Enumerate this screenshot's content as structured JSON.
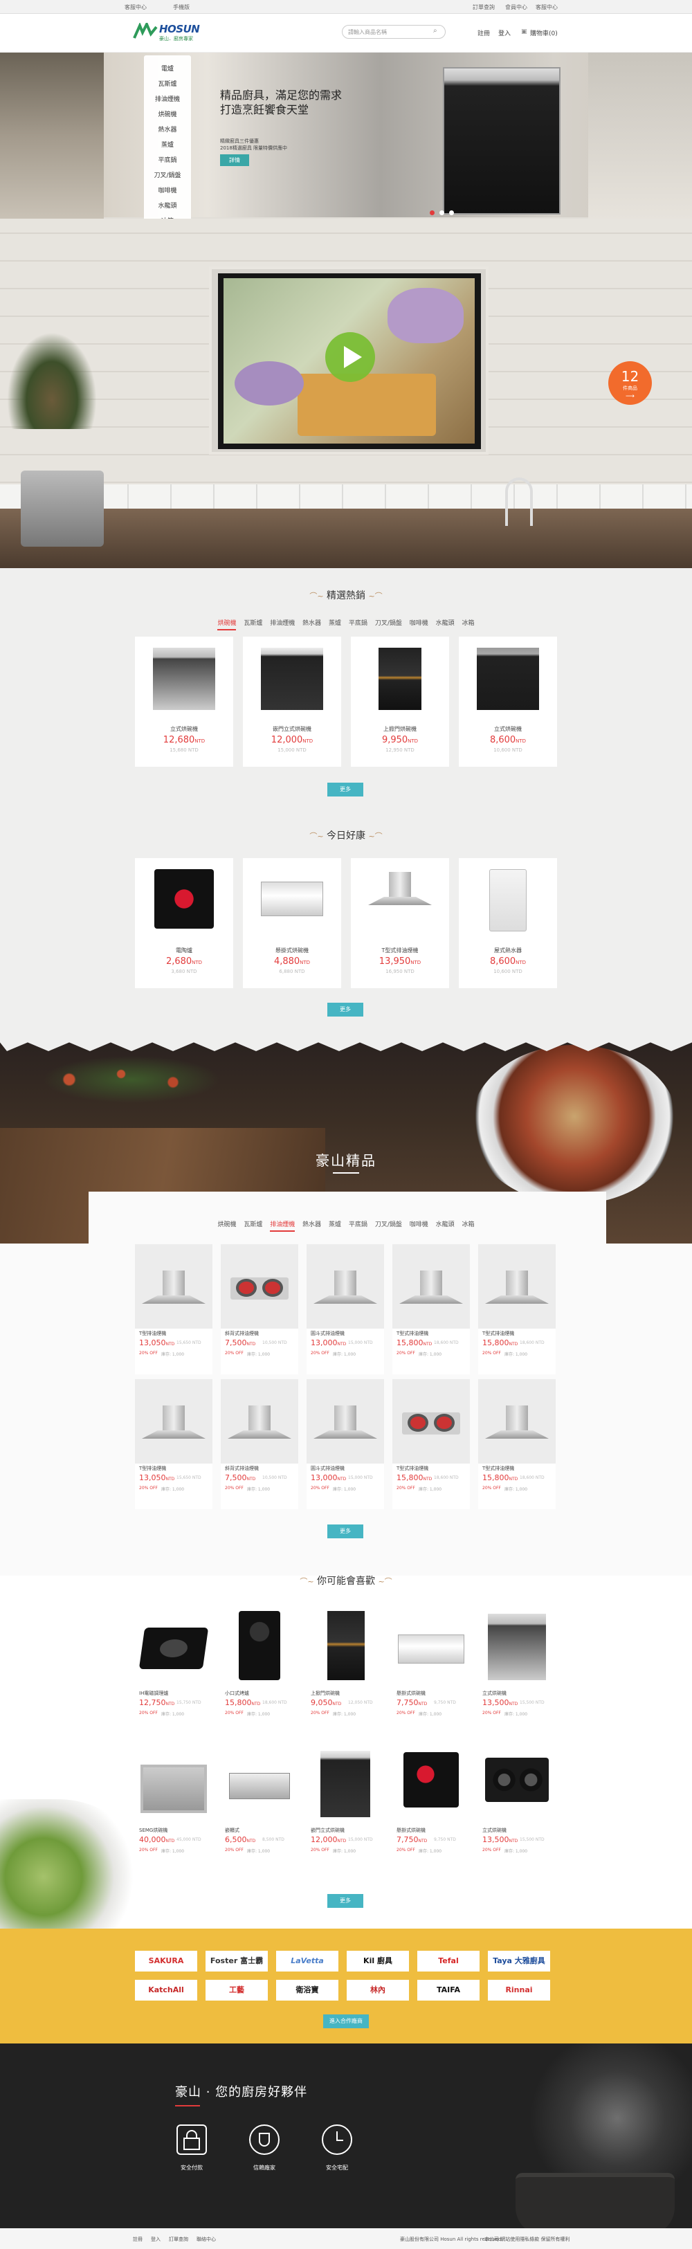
{
  "topbar": {
    "left": [
      "客服中心",
      "手機版"
    ],
    "right": [
      "訂單查詢",
      "會員中心",
      "客服中心"
    ]
  },
  "header": {
    "logo_text": "HOSUN",
    "logo_sub": "豪山．廚房專家",
    "search_placeholder": "請輸入商品名稱",
    "nav": [
      "註冊",
      "登入",
      "購物車(0)"
    ]
  },
  "categories": [
    "電爐",
    "瓦斯爐",
    "排油煙機",
    "烘碗機",
    "熱水器",
    "蒸爐",
    "平底鍋",
    "刀叉/鍋盤",
    "咖啡機",
    "水龍頭",
    "冰箱"
  ],
  "banner": {
    "title_1": "精品廚具，滿足您的需求",
    "title_2": "打造烹飪饗食天堂",
    "sub_1": "精緻廚具三件優惠",
    "sub_2": "2018精選廚具 限量特價供應中",
    "button": "詳情"
  },
  "event_badge": {
    "number": "12",
    "label": "件商品"
  },
  "hot": {
    "title": "精選熱銷",
    "tabs": [
      "烘碗機",
      "瓦斯爐",
      "排油煙機",
      "熱水器",
      "蒸爐",
      "平底鍋",
      "刀叉/鍋盤",
      "咖啡機",
      "水龍頭",
      "冰箱"
    ],
    "active_tab": 0,
    "items": [
      {
        "name": "立式烘碗機",
        "price": "12,680",
        "unit": "NTD",
        "old": "15,680 NTD"
      },
      {
        "name": "嵌門立式烘碗機",
        "price": "12,000",
        "unit": "NTD",
        "old": "15,000 NTD"
      },
      {
        "name": "上掀門烘碗機",
        "price": "9,950",
        "unit": "NTD",
        "old": "12,950 NTD"
      },
      {
        "name": "立式烘碗機",
        "price": "8,600",
        "unit": "NTD",
        "old": "10,600 NTD"
      }
    ],
    "more": "更多"
  },
  "today": {
    "title": "今日好康",
    "items": [
      {
        "name": "電陶爐",
        "price": "2,680",
        "unit": "NTD",
        "old": "3,680 NTD"
      },
      {
        "name": "懸掛式烘碗機",
        "price": "4,880",
        "unit": "NTD",
        "old": "6,880 NTD"
      },
      {
        "name": "T型式排油煙機",
        "price": "13,950",
        "unit": "NTD",
        "old": "16,950 NTD"
      },
      {
        "name": "屋式熱水器",
        "price": "8,600",
        "unit": "NTD",
        "old": "10,600 NTD"
      }
    ],
    "more": "更多"
  },
  "boutique": {
    "title": "豪山精品",
    "tabs": [
      "烘碗機",
      "瓦斯爐",
      "排油煙機",
      "熱水器",
      "蒸爐",
      "平底鍋",
      "刀叉/鍋盤",
      "咖啡機",
      "水龍頭",
      "冰箱"
    ],
    "active_tab": 2,
    "items": [
      {
        "name": "T型排油煙機",
        "price": "13,050",
        "unit": "NTD",
        "old": "15,650 NTD",
        "off": "20% OFF",
        "stock": "庫存: 1,000"
      },
      {
        "name": "斜背式排油煙機",
        "price": "7,500",
        "unit": "NTD",
        "old": "10,500 NTD",
        "off": "20% OFF",
        "stock": "庫存: 1,000"
      },
      {
        "name": "圓斗式排油煙機",
        "price": "13,000",
        "unit": "NTD",
        "old": "15,000 NTD",
        "off": "20% OFF",
        "stock": "庫存: 1,000"
      },
      {
        "name": "T型式排油煙機",
        "price": "15,800",
        "unit": "NTD",
        "old": "18,600 NTD",
        "off": "20% OFF",
        "stock": "庫存: 1,000"
      },
      {
        "name": "T型式排油煙機",
        "price": "15,800",
        "unit": "NTD",
        "old": "18,600 NTD",
        "off": "20% OFF",
        "stock": "庫存: 1,000"
      },
      {
        "name": "T型排油煙機",
        "price": "13,050",
        "unit": "NTD",
        "old": "15,650 NTD",
        "off": "20% OFF",
        "stock": "庫存: 1,000"
      },
      {
        "name": "斜背式排油煙機",
        "price": "7,500",
        "unit": "NTD",
        "old": "10,500 NTD",
        "off": "20% OFF",
        "stock": "庫存: 1,000"
      },
      {
        "name": "圓斗式排油煙機",
        "price": "13,000",
        "unit": "NTD",
        "old": "15,000 NTD",
        "off": "20% OFF",
        "stock": "庫存: 1,000"
      },
      {
        "name": "T型式排油煙機",
        "price": "15,800",
        "unit": "NTD",
        "old": "18,600 NTD",
        "off": "20% OFF",
        "stock": "庫存: 1,000"
      },
      {
        "name": "T型式排油煙機",
        "price": "15,800",
        "unit": "NTD",
        "old": "18,600 NTD",
        "off": "20% OFF",
        "stock": "庫存: 1,000"
      }
    ],
    "more": "更多"
  },
  "likes": {
    "title": "你可能會喜歡",
    "items": [
      {
        "name": "IH電磁調理爐",
        "price": "12,750",
        "unit": "NTD",
        "old": "15,750 NTD",
        "off": "20% OFF",
        "stock": "庫存: 1,000"
      },
      {
        "name": "小口式烤爐",
        "price": "15,800",
        "unit": "NTD",
        "old": "18,600 NTD",
        "off": "20% OFF",
        "stock": "庫存: 1,000"
      },
      {
        "name": "上掀門烘碗機",
        "price": "9,050",
        "unit": "NTD",
        "old": "12,050 NTD",
        "off": "20% OFF",
        "stock": "庫存: 1,000"
      },
      {
        "name": "懸掛式烘碗機",
        "price": "7,750",
        "unit": "NTD",
        "old": "9,750 NTD",
        "off": "20% OFF",
        "stock": "庫存: 1,000"
      },
      {
        "name": "立式烘碗機",
        "price": "13,500",
        "unit": "NTD",
        "old": "15,500 NTD",
        "off": "20% OFF",
        "stock": "庫存: 1,000"
      },
      {
        "name": "SEMG烘碗機",
        "price": "40,000",
        "unit": "NTD",
        "old": "45,000 NTD",
        "off": "20% OFF",
        "stock": "庫存: 1,000"
      },
      {
        "name": "嵌櫃式",
        "price": "6,500",
        "unit": "NTD",
        "old": "8,500 NTD",
        "off": "20% OFF",
        "stock": "庫存: 1,000"
      },
      {
        "name": "嵌門立式烘碗機",
        "price": "12,000",
        "unit": "NTD",
        "old": "15,000 NTD",
        "off": "20% OFF",
        "stock": "庫存: 1,000"
      },
      {
        "name": "懸掛式烘碗機",
        "price": "7,750",
        "unit": "NTD",
        "old": "9,750 NTD",
        "off": "20% OFF",
        "stock": "庫存: 1,000"
      },
      {
        "name": "立式烘碗機",
        "price": "13,500",
        "unit": "NTD",
        "old": "15,500 NTD",
        "off": "20% OFF",
        "stock": "庫存: 1,000"
      }
    ],
    "more": "更多"
  },
  "brands": {
    "items": [
      {
        "name": "SAKURA",
        "color": "#d32f2f"
      },
      {
        "name": "Foster 富士霸",
        "color": "#333333"
      },
      {
        "name": "LaVetta",
        "color": "#4a7ec9"
      },
      {
        "name": "Kil 廚具",
        "color": "#111111"
      },
      {
        "name": "Tefal",
        "color": "#d62828"
      },
      {
        "name": "Taya 大雅廚具",
        "color": "#1f4e9c"
      },
      {
        "name": "KatchAll",
        "color": "#c62828"
      },
      {
        "name": "工藝",
        "color": "#d32f2f"
      },
      {
        "name": "衛浴寶",
        "color": "#222222"
      },
      {
        "name": "林內",
        "color": "#c62828"
      },
      {
        "name": "TAIFA",
        "color": "#111111"
      },
      {
        "name": "Rinnai",
        "color": "#d32f2f"
      }
    ],
    "button": "進入合作廠商"
  },
  "footer": {
    "slogan": "豪山 · 您的廚房好夥伴",
    "features": [
      "安全付款",
      "信賴廠家",
      "安全宅配"
    ],
    "links": [
      "註冊",
      "登入",
      "訂單查詢",
      "聯絡中心"
    ],
    "copyright": "豪山股份有限公司 Hosun All rights reserved.",
    "note": "本公司 網站使用隱私條款 保留所有權利"
  },
  "colors": {
    "accent": "#e23b3b",
    "teal": "#46b5c3",
    "brand_bar": "#efbd3f",
    "badge": "#f26b2c"
  }
}
